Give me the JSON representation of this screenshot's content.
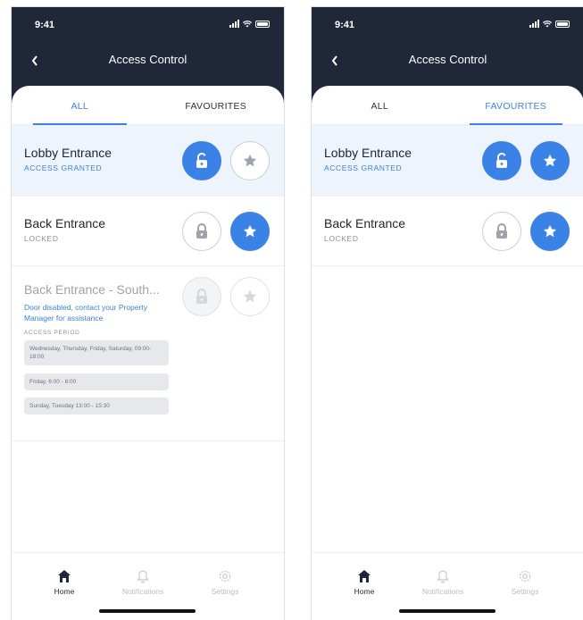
{
  "status_bar": {
    "time": "9:41"
  },
  "header": {
    "title": "Access Control"
  },
  "tabs": [
    {
      "label": "ALL"
    },
    {
      "label": "FAVOURITES"
    }
  ],
  "left_screen": {
    "active_tab": "ALL",
    "rows": [
      {
        "title": "Lobby Entrance",
        "status": "ACCESS GRANTED",
        "lock_state": "unlocked",
        "favourite": false
      },
      {
        "title": "Back Entrance",
        "status": "LOCKED",
        "lock_state": "locked",
        "favourite": true
      },
      {
        "title": "Back Entrance - South...",
        "note": "Door disabled, contact your Property Manager for assistance",
        "period_label": "ACCESS PERIOD",
        "periods": [
          "Wednesday, Thursday, Friday, Saturday, 09:00-18:00",
          "Friday, 6:00 - 8:00",
          "Sunday, Tuesday 13:00 - 15:30"
        ],
        "lock_state": "disabled",
        "favourite": false
      }
    ]
  },
  "right_screen": {
    "active_tab": "FAVOURITES",
    "rows": [
      {
        "title": "Lobby Entrance",
        "status": "ACCESS GRANTED",
        "lock_state": "unlocked",
        "favourite": true
      },
      {
        "title": "Back Entrance",
        "status": "LOCKED",
        "lock_state": "locked",
        "favourite": true
      }
    ]
  },
  "bottom_nav": [
    {
      "label": "Home",
      "icon": "home-icon",
      "active": true
    },
    {
      "label": "Notifications",
      "icon": "bell-icon",
      "active": false
    },
    {
      "label": "Settings",
      "icon": "gear-icon",
      "active": false
    }
  ],
  "colors": {
    "header_bg": "#1f2738",
    "accent": "#3b82e6",
    "highlight_row": "#eef4fc",
    "muted": "#8a8f99"
  }
}
